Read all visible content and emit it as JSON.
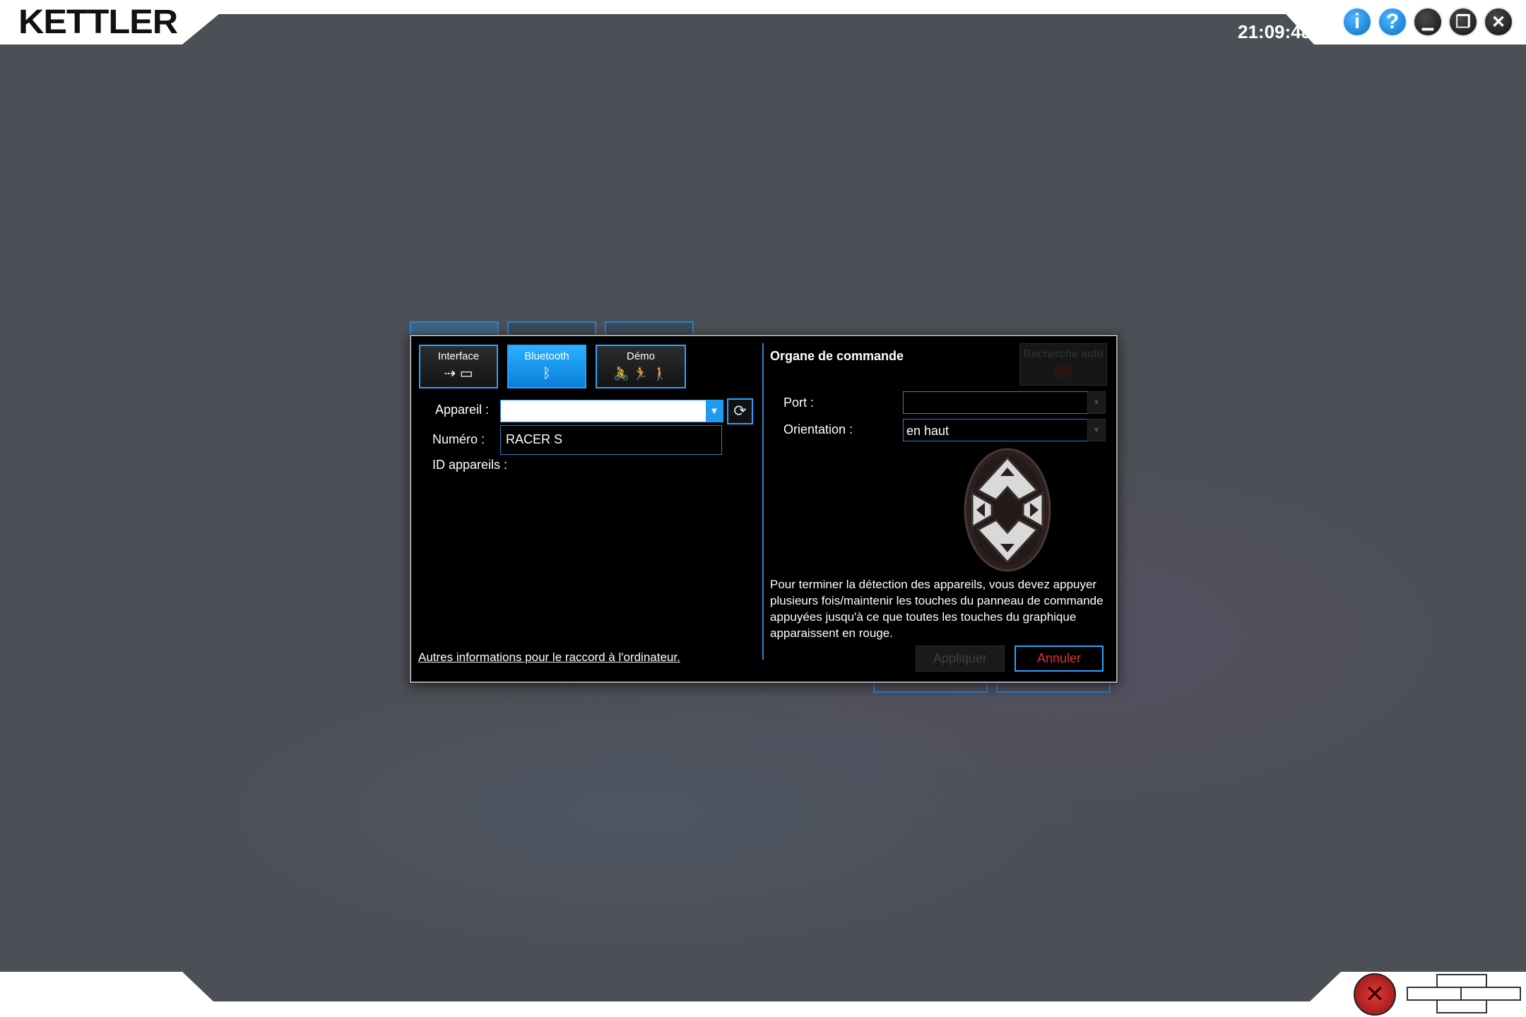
{
  "app": {
    "logo": "KETTLER",
    "clock": "21:09:48"
  },
  "window_buttons": [
    {
      "name": "info-icon",
      "glyph": "i"
    },
    {
      "name": "help-icon",
      "glyph": "?"
    },
    {
      "name": "minimize-icon",
      "glyph": "▁"
    },
    {
      "name": "restore-icon",
      "glyph": "❐"
    },
    {
      "name": "close-icon",
      "glyph": "✕"
    }
  ],
  "dialog": {
    "modes": [
      {
        "label": "Interface",
        "icon": "usb-serial-icon",
        "glyph": "⇢ ▭"
      },
      {
        "label": "Bluetooth",
        "icon": "bluetooth-icon",
        "glyph": "ᛒ"
      },
      {
        "label": "Démo",
        "icon": "fitness-equipment-icon",
        "glyph": "🚴 🏃 🚶"
      }
    ],
    "device_label": "Appareil :",
    "device_value": "",
    "number_label": "Numéro :",
    "number_value": "RACER S",
    "ids_label": "ID appareils :",
    "link": "Autres informations pour le raccord à l'ordinateur.",
    "control": {
      "title": "Organe de commande",
      "auto_search": "Recherche auto",
      "port_label": "Port :",
      "port_value": "",
      "orientation_label": "Orientation :",
      "orientation_value": "en haut",
      "instructions": "Pour terminer la détection des appareils, vous devez appuyer plusieurs fois/maintenir les touches du panneau de commande appuyées jusqu'à ce que toutes les touches du graphique apparaissent en rouge."
    },
    "apply": "Appliquer",
    "cancel": "Annuler"
  },
  "colors": {
    "accent": "#2aa3ff",
    "cancel_text": "#e53030",
    "background": "#4c4f55"
  }
}
